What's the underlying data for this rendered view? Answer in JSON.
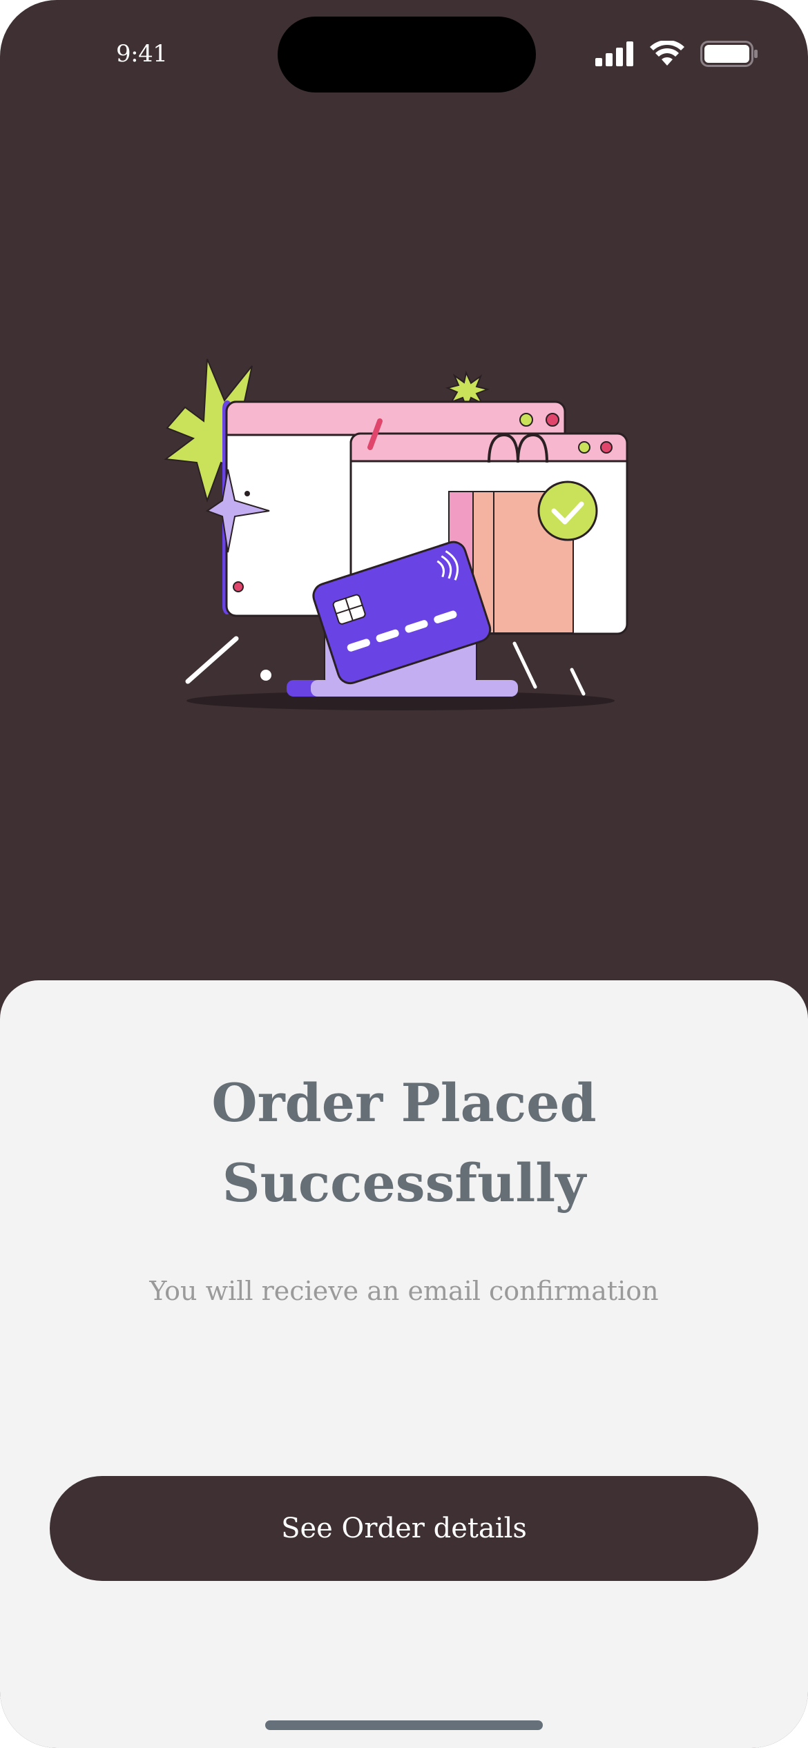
{
  "status_bar": {
    "time": "9:41",
    "icons": [
      "cellular-signal-icon",
      "wifi-icon",
      "battery-icon"
    ]
  },
  "illustration": {
    "name": "order-success-illustration",
    "colors": {
      "background": "#3f3033",
      "accent_purple": "#6a43e4",
      "light_purple": "#c4aef2",
      "pink": "#f7b7cf",
      "lime": "#c9e25a",
      "peach": "#f4b3a0"
    }
  },
  "sheet": {
    "title_line1": "Order Placed",
    "title_line2": "Successfully",
    "subtitle": "You will recieve an email confirmation",
    "cta_label": "See Order details"
  },
  "colors": {
    "sheet_background": "#f3f3f3",
    "title": "#666f75",
    "subtitle": "#9a9a9a",
    "button": "#3f3033"
  }
}
